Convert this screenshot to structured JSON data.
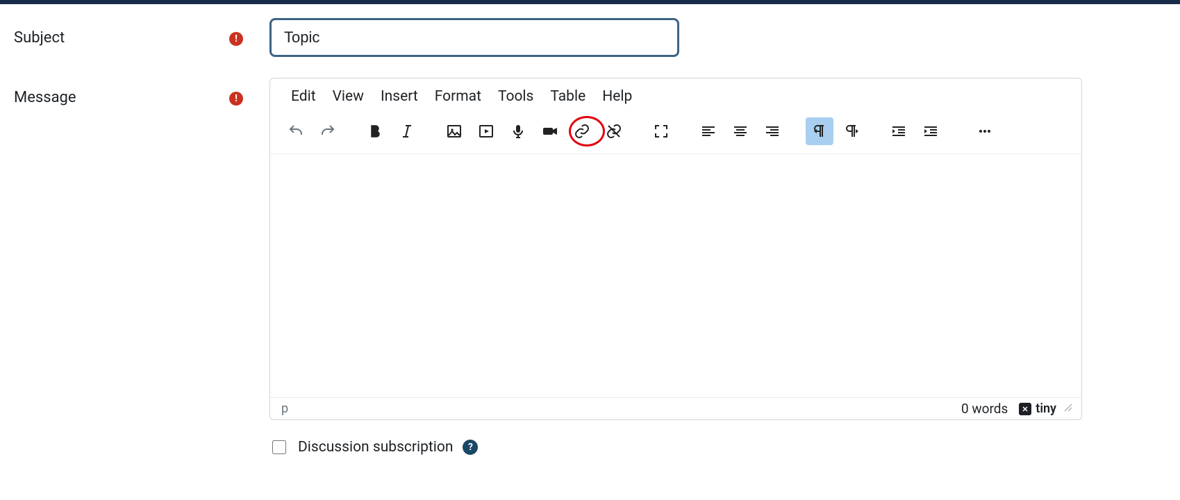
{
  "labels": {
    "subject": "Subject",
    "message": "Message"
  },
  "subject_value": "Topic",
  "editor": {
    "menus": [
      "Edit",
      "View",
      "Insert",
      "Format",
      "Tools",
      "Table",
      "Help"
    ],
    "path": "p",
    "wordcount": "0 words",
    "brand": "tiny"
  },
  "subscription": {
    "label": "Discussion subscription",
    "checked": false
  },
  "icons": {
    "required": "!",
    "help": "?"
  },
  "toolbar": {
    "undo": "undo",
    "redo": "redo",
    "bold": "bold",
    "italic": "italic",
    "image": "image",
    "media": "media",
    "mic": "microphone",
    "camera": "record-video",
    "link": "link",
    "unlink": "unlink",
    "fullscreen": "fullscreen",
    "alignleft": "align-left",
    "aligncenter": "align-center",
    "alignright": "align-right",
    "ltr": "ltr",
    "rtl": "rtl",
    "outdent": "outdent",
    "indent": "indent",
    "more": "more"
  },
  "annotation": {
    "circled_tool": "link"
  }
}
